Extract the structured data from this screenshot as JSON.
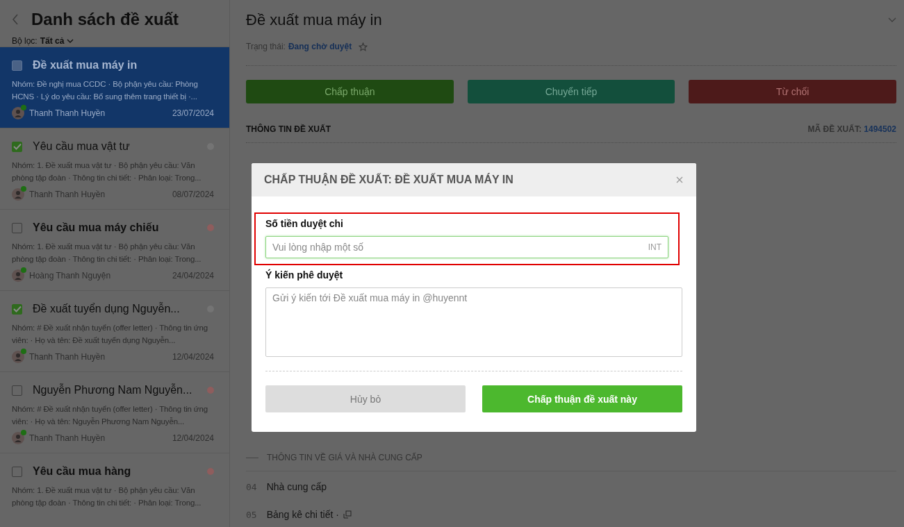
{
  "sidebar": {
    "title": "Danh sách đề xuất",
    "filter_label": "Bộ lọc:",
    "filter_value": "Tất cả"
  },
  "proposals": [
    {
      "title": "Đề xuất mua máy in",
      "selected": true,
      "checked": false,
      "unread": true,
      "desc": "Nhóm: Đề nghị mua CCDC · Bộ phận yêu cầu: Phòng HCNS · Lý do yêu cầu: Bổ sung thêm trang thiết bị ·...",
      "author": "Thanh Thanh Huyền",
      "date": "23/07/2024",
      "online": true
    },
    {
      "title": "Yêu cầu mua vật tư",
      "selected": false,
      "checked": true,
      "unread": false,
      "color": "#747474",
      "desc": "Nhóm: 1. Đề xuất mua vật tư · Bộ phận yêu cầu: Văn phòng tập đoàn · Thông tin chi tiết: · Phân loại: Trong...",
      "author": "Thanh Thanh Huyền",
      "date": "08/07/2024",
      "online": true
    },
    {
      "title": "Yêu cầu mua máy chiếu",
      "selected": false,
      "checked": false,
      "unread": true,
      "color": "#8f5d5d",
      "desc": "Nhóm: 1. Đề xuất mua vật tư · Bộ phận yêu cầu: Văn phòng tập đoàn · Thông tin chi tiết: · Phân loại: Trong...",
      "author": "Hoàng Thanh Nguyện",
      "date": "24/04/2024",
      "online": true
    },
    {
      "title": "Đề xuất tuyển dụng Nguyễn...",
      "selected": false,
      "checked": true,
      "unread": false,
      "color": "#747474",
      "desc": "Nhóm: # Đề xuất nhận tuyển (offer letter) · Thông tin ứng viên: · Họ và tên: Đề xuất tuyển dụng Nguyễn...",
      "author": "Thanh Thanh Huyền",
      "date": "12/04/2024",
      "online": true
    },
    {
      "title": "Nguyễn Phương Nam Nguyễn...",
      "selected": false,
      "checked": false,
      "unread": false,
      "color": "#8f5d5d",
      "desc": "Nhóm: # Đề xuất nhận tuyển (offer letter) · Thông tin ứng viên: · Họ và tên: Nguyễn Phương Nam Nguyễn...",
      "author": "Thanh Thanh Huyền",
      "date": "12/04/2024",
      "online": true
    },
    {
      "title": "Yêu cầu mua hàng",
      "selected": false,
      "checked": false,
      "unread": true,
      "color": "#8f5d5d",
      "desc": "Nhóm: 1. Đề xuất mua vật tư · Bộ phận yêu cầu: Văn phòng tập đoàn · Thông tin chi tiết: · Phân loại: Trong..."
    }
  ],
  "detail": {
    "title": "Đề xuất mua máy in",
    "status_label": "Trạng thái:",
    "status_value": "Đang chờ duyệt",
    "starred": false,
    "actions": [
      {
        "label": "Chấp thuận",
        "kind": "approve"
      },
      {
        "label": "Chuyển tiếp",
        "kind": "forward"
      },
      {
        "label": "Từ chối",
        "kind": "reject"
      }
    ],
    "section_title": "THÔNG TIN ĐỀ XUẤT",
    "code_label": "MÃ ĐỀ XUẤT:",
    "code_value": "1494502",
    "price_section": "THÔNG TIN VỀ GIÁ VÀ NHÀ CUNG CẤP",
    "fields": [
      {
        "number": "04",
        "label": "Nhà cung cấp",
        "kind": "text"
      },
      {
        "number": "05",
        "label": "Bảng kê chi tiết ·",
        "kind": "table"
      }
    ]
  },
  "dialog": {
    "title": "CHẤP THUẬN ĐỀ XUẤT: ĐỀ XUẤT MUA MÁY IN",
    "amount_label": "Số tiền duyệt chi",
    "amount_placeholder": "Vui lòng nhập một số",
    "amount_unit": "INT",
    "comment_label": "Ý kiến phê duyệt",
    "comment_placeholder": "Gửi ý kiến tới Đề xuất mua máy in @huyennt",
    "cancel": "Hủy bỏ",
    "confirm": "Chấp thuận đề xuất này"
  }
}
